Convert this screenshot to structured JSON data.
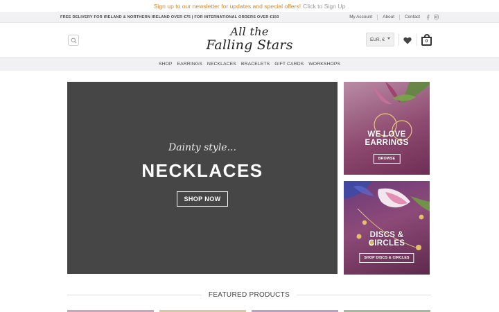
{
  "newsletter": {
    "promo_text": "Sign up to our newsletter for updates and special offers!",
    "cta_text": "Click to Sign Up"
  },
  "topbar": {
    "delivery_text": "FREE DELIVERY FOR IRELAND & NORTHERN IRELAND OVER €75 | FOR INTERNATIONAL ORDERS OVER €150",
    "links": [
      "My Account",
      "About",
      "Contact"
    ],
    "social_icons": [
      "facebook-icon",
      "instagram-icon"
    ]
  },
  "header": {
    "logo_line1": "All the",
    "logo_line2": "Falling Stars",
    "currency": "EUR, €",
    "cart_count": "0"
  },
  "nav": {
    "items": [
      "SHOP",
      "EARRINGS",
      "NECKLACES",
      "BRACELETS",
      "GIFT CARDS",
      "WORKSHOPS"
    ]
  },
  "hero": {
    "pretitle": "Dainty style...",
    "title": "NECKLACES",
    "button": "SHOP NOW"
  },
  "tiles": {
    "earrings": {
      "title_line1": "WE LOVE",
      "title_line2": "EARRINGS",
      "button": "BROWSE"
    },
    "discs": {
      "title_line1": "DISCS &",
      "title_line2": "CIRCLES",
      "button": "SHOP DISCS & CIRCLES"
    }
  },
  "featured": {
    "label": "FEATURED PRODUCTS"
  },
  "colors": {
    "promo": "#d48a2c",
    "hero_bg": "#464646",
    "bar_bg": "#f1f1f3"
  }
}
